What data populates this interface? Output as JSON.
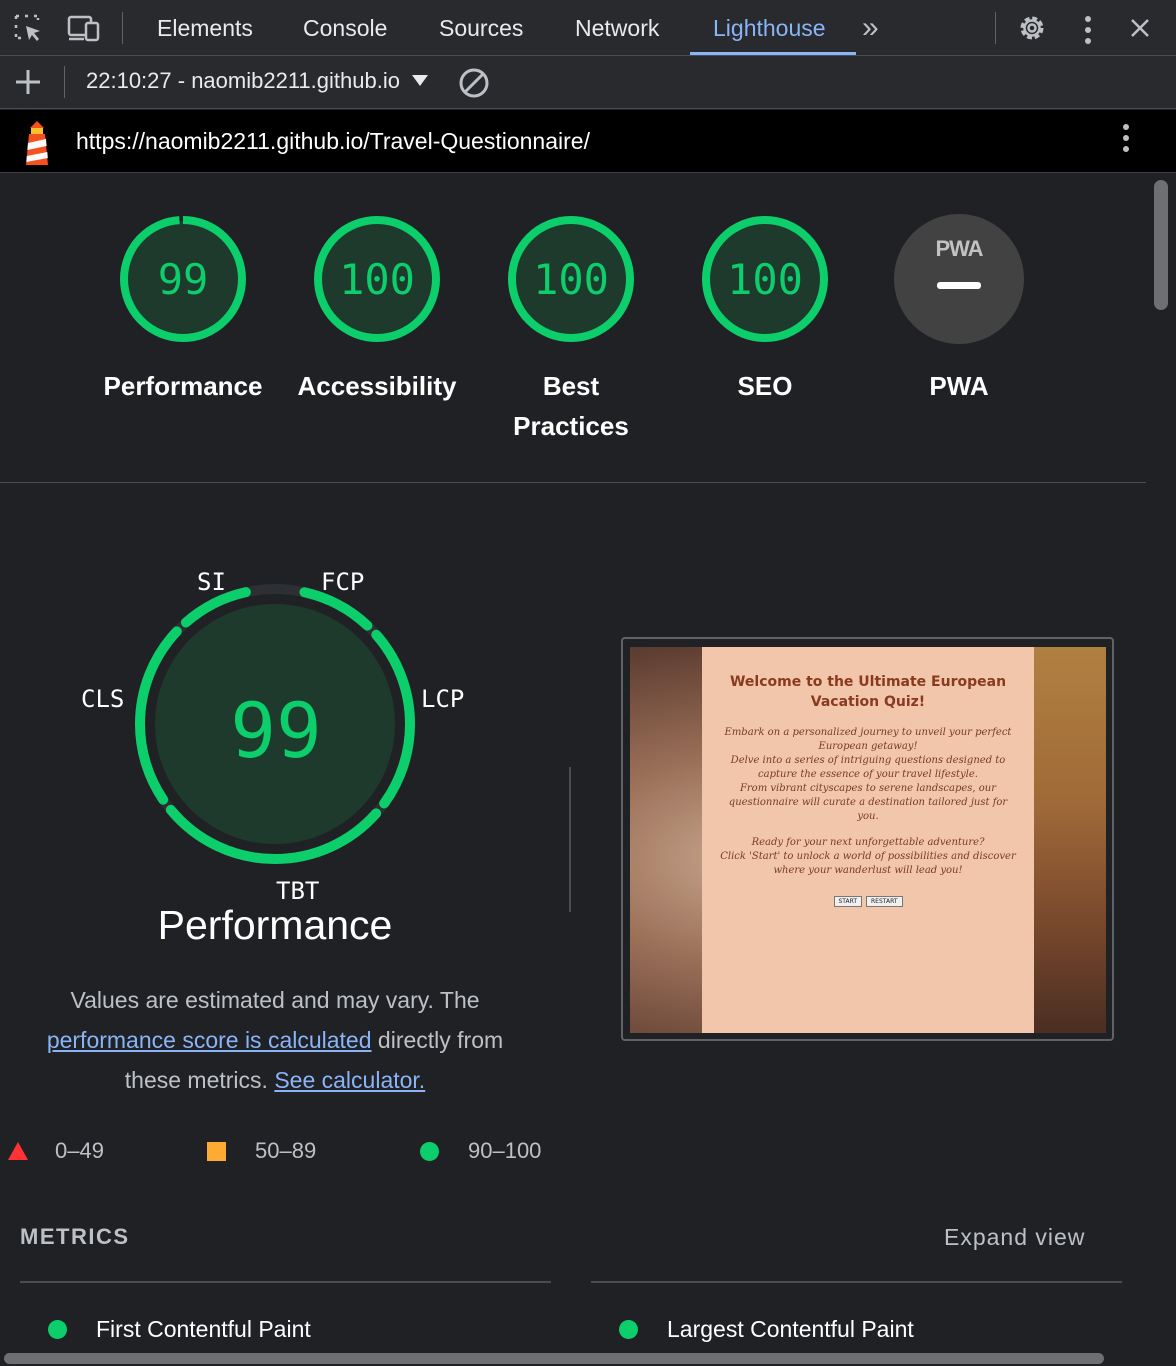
{
  "devtools": {
    "tabs": [
      "Elements",
      "Console",
      "Sources",
      "Network",
      "Lighthouse"
    ],
    "active_tab": "Lighthouse",
    "more_tabs_glyph": "»"
  },
  "toolbar": {
    "report_label": "22:10:27 - naomib2211.github.io",
    "new_report_icon": "plus-icon",
    "clear_icon": "block-icon"
  },
  "urlbar": {
    "url": "https://naomib2211.github.io/Travel-Questionnaire/"
  },
  "gauges": [
    {
      "label": "Performance",
      "value": "99",
      "score": 99
    },
    {
      "label": "Accessibility",
      "value": "100",
      "score": 100
    },
    {
      "label": "Best Practices",
      "value": "100",
      "score": 100
    },
    {
      "label": "SEO",
      "value": "100",
      "score": 100
    },
    {
      "label": "PWA",
      "value": "",
      "badge_text": "PWA"
    }
  ],
  "performance": {
    "score": "99",
    "title": "Performance",
    "metric_tags": {
      "si": "SI",
      "fcp": "FCP",
      "lcp": "LCP",
      "tbt": "TBT",
      "cls": "CLS"
    },
    "desc_part1": "Values are estimated and may vary. The",
    "desc_link1": "performance score is calculated",
    "desc_part2": "directly from these metrics.",
    "desc_link2": "See calculator."
  },
  "legend": [
    {
      "range": "0–49",
      "color": "#ff3333",
      "shape": "triangle"
    },
    {
      "range": "50–89",
      "color": "#ffaa33",
      "shape": "square"
    },
    {
      "range": "90–100",
      "color": "#0cce6b",
      "shape": "circle"
    }
  ],
  "screenshot": {
    "title": "Welcome to the Ultimate European Vacation Quiz!",
    "lines": [
      "Embark on a personalized journey to unveil your perfect European getaway!",
      "Delve into a series of intriguing questions designed to capture the essence of your travel lifestyle.",
      "From vibrant cityscapes to serene landscapes, our questionnaire will curate a destination tailored just for you.",
      "Ready for your next unforgettable adventure?",
      "Click 'Start' to unlock a world of possibilities and discover where your wanderlust will lead you!"
    ],
    "buttons": [
      "START",
      "RESTART"
    ]
  },
  "metrics": {
    "heading": "METRICS",
    "expand_label": "Expand view",
    "items": [
      "First Contentful Paint",
      "Largest Contentful Paint"
    ]
  },
  "colors": {
    "pass": "#0cce6b",
    "link": "#8ab4f8",
    "bg": "#202124"
  }
}
